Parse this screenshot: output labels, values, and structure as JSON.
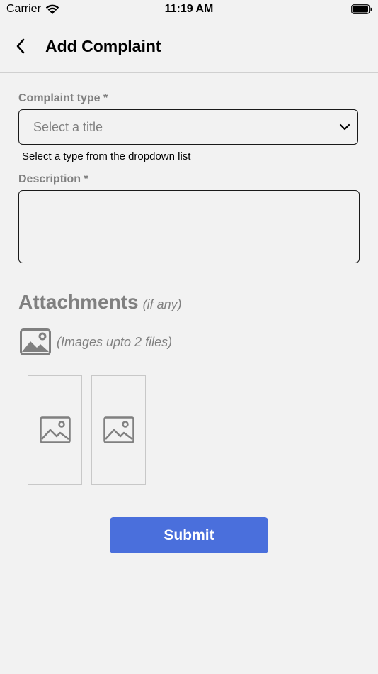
{
  "status_bar": {
    "carrier": "Carrier",
    "time": "11:19 AM"
  },
  "nav": {
    "title": "Add Complaint",
    "back_icon": "chevron-left-icon"
  },
  "form": {
    "complaint_type": {
      "label": "Complaint type *",
      "placeholder": "Select a title",
      "helper": "Select a type from the dropdown list"
    },
    "description": {
      "label": "Description *",
      "value": ""
    }
  },
  "attachments": {
    "title": "Attachments",
    "note": "(if any)",
    "hint": "(Images upto 2 files)",
    "picker_icon": "image-icon",
    "slots": 2
  },
  "submit": {
    "label": "Submit"
  },
  "colors": {
    "background": "#f2f2f2",
    "label_gray": "#808080",
    "primary": "#4a6fdc"
  }
}
